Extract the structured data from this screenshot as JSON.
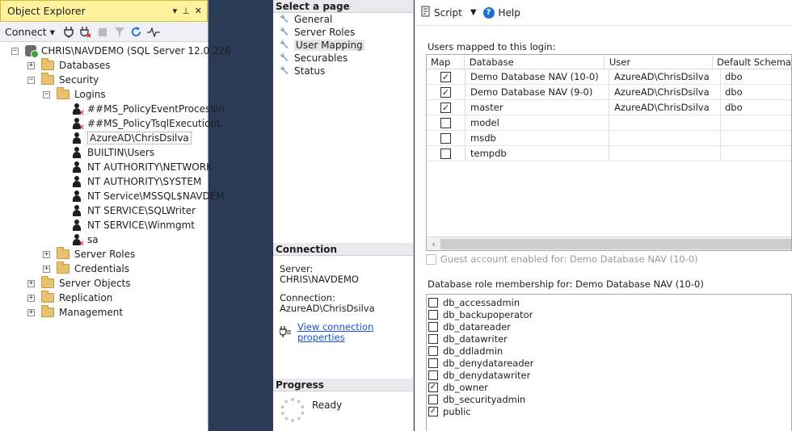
{
  "object_explorer": {
    "title": "Object Explorer",
    "connect_label": "Connect",
    "tree": [
      {
        "label": "CHRIS\\NAVDEMO (SQL Server 12.0.226",
        "type": "server",
        "expander": "−",
        "indent": 0
      },
      {
        "label": "Databases",
        "type": "folder",
        "expander": "+",
        "indent": 1
      },
      {
        "label": "Security",
        "type": "folder",
        "expander": "−",
        "indent": 1
      },
      {
        "label": "Logins",
        "type": "folder",
        "expander": "−",
        "indent": 2
      },
      {
        "label": "##MS_PolicyEventProcessin",
        "type": "user-disabled",
        "indent": 3
      },
      {
        "label": "##MS_PolicyTsqlExecutionL",
        "type": "user-disabled",
        "indent": 3
      },
      {
        "label": "AzureAD\\ChrisDsilva",
        "type": "user",
        "indent": 3,
        "selected": true
      },
      {
        "label": "BUILTIN\\Users",
        "type": "user",
        "indent": 3
      },
      {
        "label": "NT AUTHORITY\\NETWORK",
        "type": "user",
        "indent": 3
      },
      {
        "label": "NT AUTHORITY\\SYSTEM",
        "type": "user",
        "indent": 3
      },
      {
        "label": "NT Service\\MSSQL$NAVDEM",
        "type": "user",
        "indent": 3
      },
      {
        "label": "NT SERVICE\\SQLWriter",
        "type": "user",
        "indent": 3
      },
      {
        "label": "NT SERVICE\\Winmgmt",
        "type": "user",
        "indent": 3
      },
      {
        "label": "sa",
        "type": "user-disabled",
        "indent": 3
      },
      {
        "label": "Server Roles",
        "type": "folder",
        "expander": "+",
        "indent": 2
      },
      {
        "label": "Credentials",
        "type": "folder",
        "expander": "+",
        "indent": 2
      },
      {
        "label": "Server Objects",
        "type": "folder",
        "expander": "+",
        "indent": 1
      },
      {
        "label": "Replication",
        "type": "folder",
        "expander": "+",
        "indent": 1
      },
      {
        "label": "Management",
        "type": "folder",
        "expander": "+",
        "indent": 1
      }
    ]
  },
  "select_page": {
    "header": "Select a page",
    "pages": [
      "General",
      "Server Roles",
      "User Mapping",
      "Securables",
      "Status"
    ],
    "active": "User Mapping"
  },
  "connection": {
    "header": "Connection",
    "server_label": "Server:",
    "server_value": "CHRIS\\NAVDEMO",
    "connection_label": "Connection:",
    "connection_value": "AzureAD\\ChrisDsilva",
    "link": "View connection properties"
  },
  "progress": {
    "header": "Progress",
    "status": "Ready"
  },
  "toolbar": {
    "script_label": "Script",
    "help_label": "Help"
  },
  "mapping": {
    "label": "Users mapped to this login:",
    "columns": [
      "Map",
      "Database",
      "User",
      "Default Schema"
    ],
    "rows": [
      {
        "map": true,
        "database": "Demo Database NAV (10-0)",
        "user": "AzureAD\\ChrisDsilva",
        "schema": "dbo"
      },
      {
        "map": true,
        "database": "Demo Database NAV (9-0)",
        "user": "AzureAD\\ChrisDsilva",
        "schema": "dbo"
      },
      {
        "map": true,
        "database": "master",
        "user": "AzureAD\\ChrisDsilva",
        "schema": "dbo"
      },
      {
        "map": false,
        "database": "model",
        "user": "",
        "schema": ""
      },
      {
        "map": false,
        "database": "msdb",
        "user": "",
        "schema": ""
      },
      {
        "map": false,
        "database": "tempdb",
        "user": "",
        "schema": ""
      }
    ]
  },
  "guest": {
    "label": "Guest account enabled for: Demo Database NAV (10-0)"
  },
  "roles": {
    "label": "Database role membership for: Demo Database NAV (10-0)",
    "items": [
      {
        "name": "db_accessadmin",
        "checked": false
      },
      {
        "name": "db_backupoperator",
        "checked": false
      },
      {
        "name": "db_datareader",
        "checked": false
      },
      {
        "name": "db_datawriter",
        "checked": false
      },
      {
        "name": "db_ddladmin",
        "checked": false
      },
      {
        "name": "db_denydatareader",
        "checked": false
      },
      {
        "name": "db_denydatawriter",
        "checked": false
      },
      {
        "name": "db_owner",
        "checked": true
      },
      {
        "name": "db_securityadmin",
        "checked": false
      },
      {
        "name": "public",
        "checked": true
      }
    ]
  }
}
